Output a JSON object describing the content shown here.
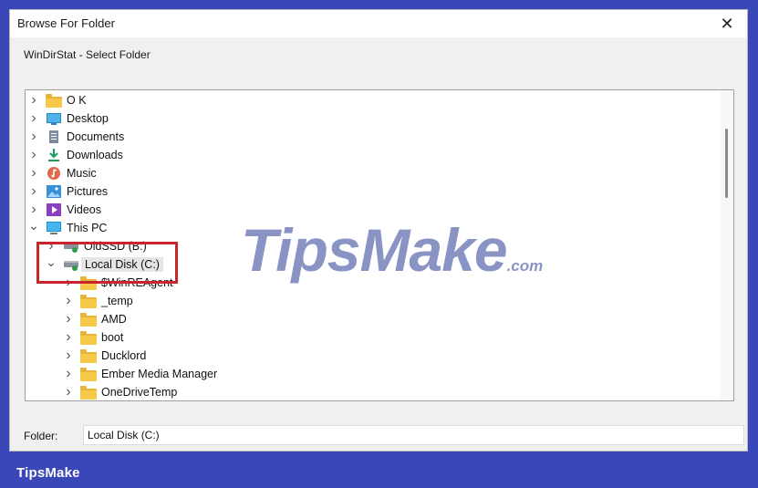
{
  "dialog": {
    "title": "Browse For Folder",
    "close_glyph": "✕",
    "subtitle": "WinDirStat - Select Folder"
  },
  "tree": {
    "items": [
      {
        "label": "O K",
        "icon": "folder-icon",
        "expanded": false
      },
      {
        "label": "Desktop",
        "icon": "desktop-icon",
        "expanded": false
      },
      {
        "label": "Documents",
        "icon": "documents-icon",
        "expanded": false
      },
      {
        "label": "Downloads",
        "icon": "downloads-icon",
        "expanded": false
      },
      {
        "label": "Music",
        "icon": "music-icon",
        "expanded": false
      },
      {
        "label": "Pictures",
        "icon": "pictures-icon",
        "expanded": false
      },
      {
        "label": "Videos",
        "icon": "videos-icon",
        "expanded": false
      },
      {
        "label": "This PC",
        "icon": "this-pc-icon",
        "expanded": true
      },
      {
        "label": "OldSSD (B:)",
        "icon": "drive-icon",
        "expanded": false
      },
      {
        "label": "Local Disk (C:)",
        "icon": "drive-icon",
        "expanded": true,
        "selected": true
      },
      {
        "label": "$WinREAgent",
        "icon": "folder-icon",
        "expanded": false
      },
      {
        "label": "_temp",
        "icon": "folder-icon",
        "expanded": false
      },
      {
        "label": "AMD",
        "icon": "folder-icon",
        "expanded": false
      },
      {
        "label": "boot",
        "icon": "folder-icon",
        "expanded": false
      },
      {
        "label": "Ducklord",
        "icon": "folder-icon",
        "expanded": false
      },
      {
        "label": "Ember Media Manager",
        "icon": "folder-icon",
        "expanded": false
      },
      {
        "label": "OneDriveTemp",
        "icon": "folder-icon",
        "expanded": false
      }
    ]
  },
  "folder_field": {
    "label": "Folder:",
    "value": "Local Disk (C:)"
  },
  "watermark": {
    "main": "TipsMake",
    "suffix": ".com"
  },
  "footer": {
    "brand": "TipsMake"
  },
  "colors": {
    "accent": "#3a47b8",
    "highlight": "#c8262a",
    "folder": "#f6c94a"
  }
}
